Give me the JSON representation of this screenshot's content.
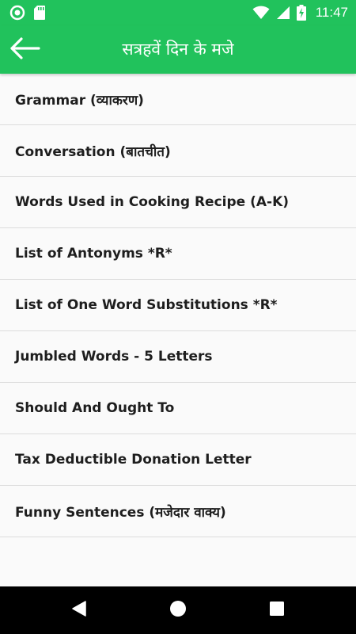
{
  "status_bar": {
    "time": "11:47",
    "icons": [
      "circle-notification-icon",
      "sd-card-icon",
      "wifi-icon",
      "signal-icon",
      "battery-charging-icon"
    ]
  },
  "app_bar": {
    "title": "सत्रहवें दिन के मजे",
    "back_icon": "arrow-left-icon",
    "color": "#21c25c"
  },
  "list": {
    "items": [
      {
        "label": "Grammar (व्याकरण)"
      },
      {
        "label": "Conversation (बातचीत)"
      },
      {
        "label": "Words Used in Cooking Recipe (A-K)"
      },
      {
        "label": "List of Antonyms *R*"
      },
      {
        "label": "List of One Word Substitutions *R*"
      },
      {
        "label": "Jumbled Words - 5 Letters"
      },
      {
        "label": "Should And Ought To"
      },
      {
        "label": "Tax Deductible Donation Letter"
      },
      {
        "label": "Funny Sentences (मजेदार वाक्य)"
      }
    ]
  },
  "nav_bar": {
    "icons": [
      "back-triangle-icon",
      "home-circle-icon",
      "recents-square-icon"
    ]
  }
}
